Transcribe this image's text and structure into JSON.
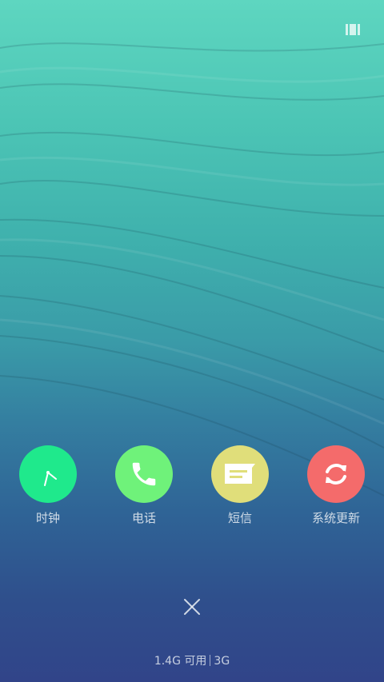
{
  "apps": [
    {
      "label": "时钟",
      "icon": "clock-icon",
      "color": "#1fe98c"
    },
    {
      "label": "电话",
      "icon": "phone-icon",
      "color": "#6ff27a"
    },
    {
      "label": "短信",
      "icon": "message-icon",
      "color": "#e0de7a"
    },
    {
      "label": "系统更新",
      "icon": "refresh-icon",
      "color": "#f46b6b"
    }
  ],
  "footer": {
    "memory": "1.4G 可用",
    "network": "3G"
  }
}
